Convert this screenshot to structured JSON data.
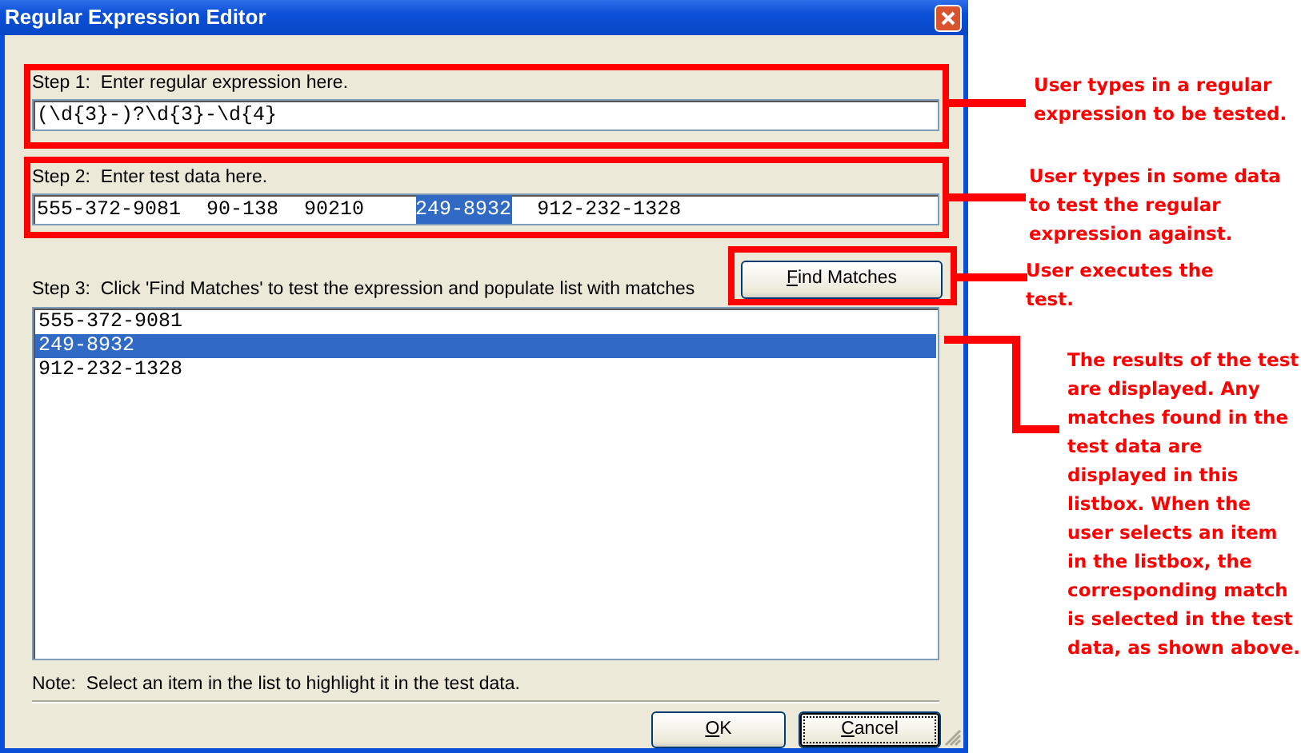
{
  "window": {
    "title": "Regular Expression Editor"
  },
  "step1": {
    "label": "Step 1:  Enter regular expression here.",
    "value": "(\\d{3}-)?\\d{3}-\\d{4}"
  },
  "step2": {
    "label": "Step 2:  Enter test data here.",
    "tokens": [
      {
        "text": "555-372-9081",
        "selected": false
      },
      {
        "text": "90-138",
        "selected": false
      },
      {
        "text": "90210",
        "selected": false
      },
      {
        "text": "249-8932",
        "selected": true
      },
      {
        "text": "912-232-1328",
        "selected": false
      }
    ]
  },
  "find_button": {
    "access_key": "F",
    "label_rest": "ind Matches"
  },
  "step3": {
    "label": "Step 3:  Click 'Find Matches' to test the expression and populate list with matches",
    "matches": [
      {
        "text": "555-372-9081",
        "selected": false
      },
      {
        "text": "249-8932",
        "selected": true
      },
      {
        "text": "912-232-1328",
        "selected": false
      }
    ]
  },
  "note": "Note:  Select an item in the list to highlight it in the test data.",
  "buttons": [
    {
      "access_key": "O",
      "label_rest": "K",
      "focused": false
    },
    {
      "access_key": "C",
      "label_rest": "ancel",
      "focused": true
    }
  ],
  "annotations": [
    {
      "text": "User types in a regular expression to be tested."
    },
    {
      "text": "User types in some data to test the regular expression against."
    },
    {
      "text": "User executes the test."
    },
    {
      "text": "The results of the test are displayed.  Any matches found in the test data are displayed in this listbox.  When the user selects an item in the listbox, the corresponding match is selected in the test data, as shown above."
    }
  ]
}
